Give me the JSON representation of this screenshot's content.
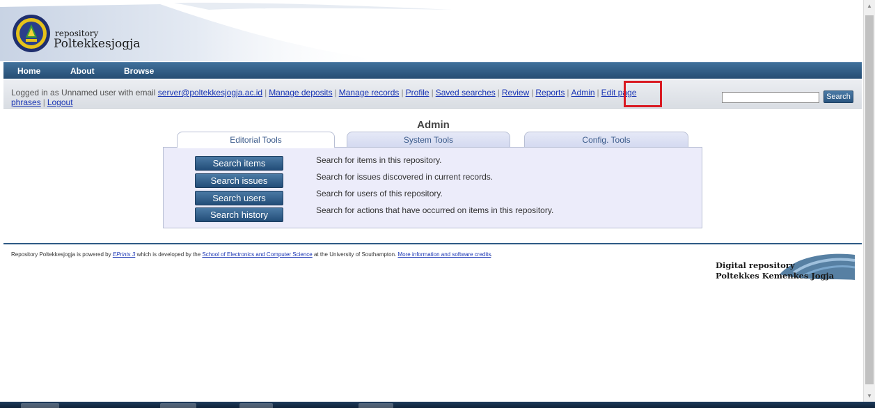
{
  "header": {
    "logo_line1": "repository",
    "logo_line2": "Poltekkesjogja"
  },
  "nav": {
    "items": [
      "Home",
      "About",
      "Browse"
    ]
  },
  "loginbar": {
    "prefix": "Logged in as Unnamed user with email",
    "email": "server@poltekkesjogja.ac.id",
    "links": [
      "Manage deposits",
      "Manage records",
      "Profile",
      "Saved searches",
      "Review",
      "Reports",
      "Admin",
      "Edit page phrases",
      "Logout"
    ],
    "edit_page_part1": "Edit page",
    "edit_page_part2": "phrases",
    "search_button": "Search",
    "search_value": ""
  },
  "admin": {
    "title": "Admin",
    "tabs": [
      "Editorial Tools",
      "System Tools",
      "Config. Tools"
    ],
    "active_tab": "Editorial Tools",
    "actions": [
      {
        "button": "Search items",
        "description": "Search for items in this repository."
      },
      {
        "button": "Search issues",
        "description": "Search for issues discovered in current records."
      },
      {
        "button": "Search users",
        "description": "Search for users of this repository."
      },
      {
        "button": "Search history",
        "description": "Search for actions that have occurred on items in this repository."
      }
    ]
  },
  "footer": {
    "text_a": "Repository Poltekkesjogja is powered by",
    "eprints_link": "EPrints 3",
    "text_b": "which is developed by the",
    "school_link": "School of Electronics and Computer Science",
    "text_c": "at the University of Southampton.",
    "more_link": "More information and software credits",
    "text_d": ".",
    "logo_line1": "Digital repository",
    "logo_line2": "Poltekkes Kemenkes Jogja"
  },
  "colors": {
    "nav_bar": "#2e5a85",
    "link": "#1a35b4",
    "highlight": "#d91a22",
    "panel": "#ececfa"
  }
}
